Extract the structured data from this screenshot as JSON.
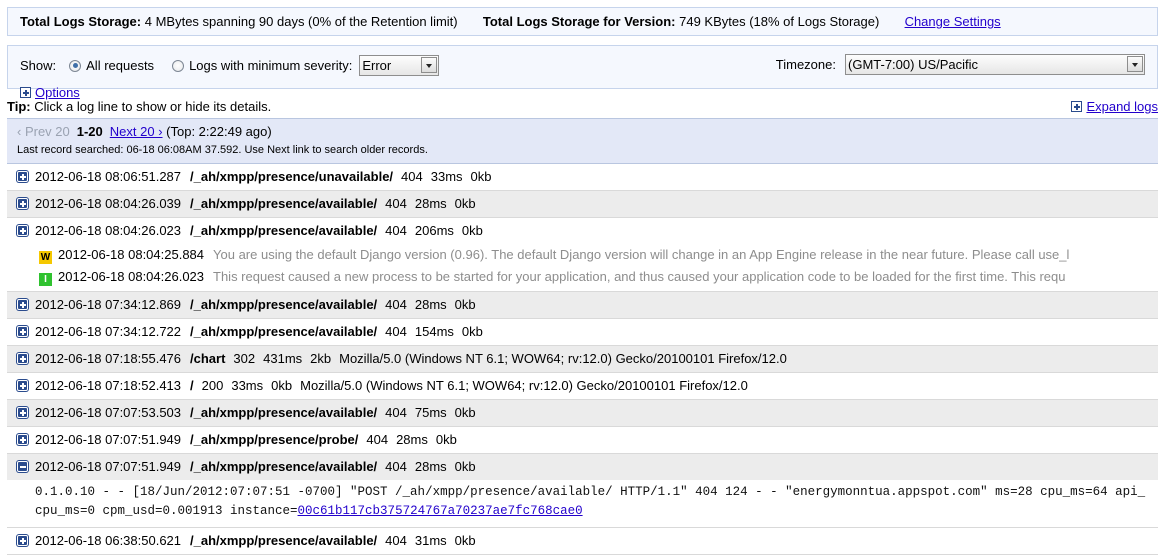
{
  "storage_bar": {
    "total_label": "Total Logs Storage:",
    "total_value": "4 MBytes spanning 90 days (0% of the Retention limit)",
    "version_label": "Total Logs Storage for Version:",
    "version_value": "749 KBytes (18% of Logs Storage)",
    "change_settings": "Change Settings"
  },
  "filters": {
    "show_label": "Show:",
    "all_requests_label": "All requests",
    "min_severity_label": "Logs with minimum severity:",
    "severity_selected": "Error",
    "severity_options": [
      "Error"
    ],
    "timezone_label": "Timezone:",
    "timezone_selected": "(GMT-7:00) US/Pacific",
    "timezone_options": [
      "(GMT-7:00) US/Pacific"
    ],
    "options_label": "Options"
  },
  "tip": {
    "lead": "Tip:",
    "text": " Click a log line to show or hide its details.",
    "expand_logs": "Expand logs"
  },
  "pager": {
    "prev": "‹ Prev 20",
    "range": "1-20",
    "next": "Next 20 ›",
    "top_info": "(Top: 2:22:49 ago)",
    "last_record": "Last record searched: 06-18 06:08AM 37.592. Use Next link to search older records."
  },
  "logs": [
    {
      "expanded": false,
      "timestamp": "2012-06-18 08:06:51.287",
      "path": "/_ah/xmpp/presence/unavailable/",
      "status": "404",
      "latency": "33ms",
      "size": "0kb",
      "user_agent": ""
    },
    {
      "expanded": false,
      "timestamp": "2012-06-18 08:04:26.039",
      "path": "/_ah/xmpp/presence/available/",
      "status": "404",
      "latency": "28ms",
      "size": "0kb",
      "user_agent": ""
    },
    {
      "expanded": true,
      "timestamp": "2012-06-18 08:04:26.023",
      "path": "/_ah/xmpp/presence/available/",
      "status": "404",
      "latency": "206ms",
      "size": "0kb",
      "user_agent": "",
      "sublines": [
        {
          "severity": "W",
          "timestamp": "2012-06-18 08:04:25.884",
          "message": "You are using the default Django version (0.96). The default Django version will change in an App Engine release in the near future. Please call use_l"
        },
        {
          "severity": "I",
          "timestamp": "2012-06-18 08:04:26.023",
          "message": "This request caused a new process to be started for your application, and thus caused your application code to be loaded for the first time. This requ"
        }
      ]
    },
    {
      "expanded": false,
      "timestamp": "2012-06-18 07:34:12.869",
      "path": "/_ah/xmpp/presence/available/",
      "status": "404",
      "latency": "28ms",
      "size": "0kb",
      "user_agent": ""
    },
    {
      "expanded": false,
      "timestamp": "2012-06-18 07:34:12.722",
      "path": "/_ah/xmpp/presence/available/",
      "status": "404",
      "latency": "154ms",
      "size": "0kb",
      "user_agent": ""
    },
    {
      "expanded": false,
      "timestamp": "2012-06-18 07:18:55.476",
      "path": "/chart",
      "status": "302",
      "latency": "431ms",
      "size": "2kb",
      "user_agent": "Mozilla/5.0 (Windows NT 6.1; WOW64; rv:12.0) Gecko/20100101 Firefox/12.0"
    },
    {
      "expanded": false,
      "timestamp": "2012-06-18 07:18:52.413",
      "path": "/",
      "status": "200",
      "latency": "33ms",
      "size": "0kb",
      "user_agent": "Mozilla/5.0 (Windows NT 6.1; WOW64; rv:12.0) Gecko/20100101 Firefox/12.0"
    },
    {
      "expanded": false,
      "timestamp": "2012-06-18 07:07:53.503",
      "path": "/_ah/xmpp/presence/available/",
      "status": "404",
      "latency": "75ms",
      "size": "0kb",
      "user_agent": ""
    },
    {
      "expanded": false,
      "timestamp": "2012-06-18 07:07:51.949",
      "path": "/_ah/xmpp/presence/probe/",
      "status": "404",
      "latency": "28ms",
      "size": "0kb",
      "user_agent": ""
    },
    {
      "expanded": true,
      "collapse": true,
      "timestamp": "2012-06-18 07:07:51.949",
      "path": "/_ah/xmpp/presence/available/",
      "status": "404",
      "latency": "28ms",
      "size": "0kb",
      "user_agent": "",
      "detail_pre": "0.1.0.10 - - [18/Jun/2012:07:07:51 -0700] \"POST /_ah/xmpp/presence/available/ HTTP/1.1\" 404 124 - - \"energymonntua.appspot.com\" ms=28 cpu_ms=64 api_cpu_ms=0 cpm_usd=0.001913 instance=",
      "detail_link": "00c61b117cb375724767a70237ae7fc768cae0"
    },
    {
      "expanded": false,
      "timestamp": "2012-06-18 06:38:50.621",
      "path": "/_ah/xmpp/presence/available/",
      "status": "404",
      "latency": "31ms",
      "size": "0kb",
      "user_agent": ""
    }
  ]
}
